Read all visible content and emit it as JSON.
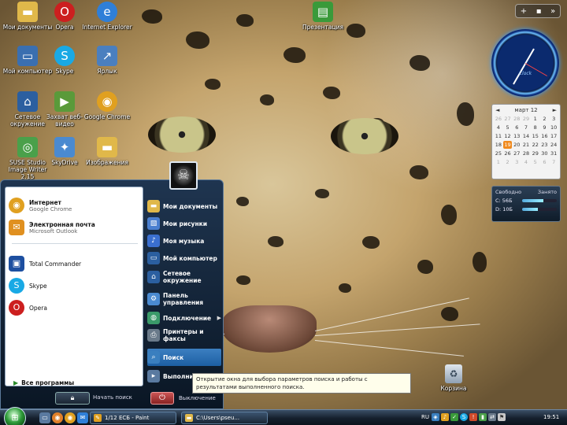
{
  "desktop": {
    "icons": [
      {
        "label": "Мои документы",
        "icon": "folder-icon",
        "color": "#e0b84a"
      },
      {
        "label": "Opera",
        "icon": "opera-icon",
        "color": "#cc1f1f"
      },
      {
        "label": "Internet Explorer",
        "icon": "ie-icon",
        "color": "#2f7fd8"
      },
      {
        "label": "Мой компьютер",
        "icon": "computer-icon",
        "color": "#3a6fb0"
      },
      {
        "label": "Skype",
        "icon": "skype-icon",
        "color": "#19a9e5"
      },
      {
        "label": "Ярлык",
        "icon": "shortcut-icon",
        "color": "#4a7fbf"
      },
      {
        "label": "Сетевое окружение",
        "icon": "network-icon",
        "color": "#2b5fa0"
      },
      {
        "label": "Захват веб-видео",
        "icon": "video-icon",
        "color": "#5a9a3a"
      },
      {
        "label": "Google Chrome",
        "icon": "chrome-icon",
        "color": "#e0a020"
      },
      {
        "label": "SUSE Studio Image Writer 2.15",
        "icon": "writer-icon",
        "color": "#4aa04a"
      },
      {
        "label": "SkyDrive",
        "icon": "skydrive-icon",
        "color": "#4a8ad0"
      },
      {
        "label": "Изображения",
        "icon": "pictures-folder-icon",
        "color": "#e0b84a"
      },
      {
        "label": "Презентация",
        "icon": "presentation-icon",
        "color": "#3a9a3a"
      }
    ],
    "recycle_bin": "Корзина"
  },
  "gadgets": {
    "controls": [
      "+",
      "▪",
      "»"
    ],
    "clock_brand": "Clock",
    "calendar": {
      "month": "март 12",
      "days": [
        "26",
        "27",
        "28",
        "29",
        "1",
        "2",
        "3",
        "4",
        "5",
        "6",
        "7",
        "8",
        "9",
        "10",
        "11",
        "12",
        "13",
        "14",
        "15",
        "16",
        "17",
        "18",
        "19",
        "20",
        "21",
        "22",
        "23",
        "24",
        "25",
        "26",
        "27",
        "28",
        "29",
        "30",
        "31",
        "1",
        "2",
        "3",
        "4",
        "5",
        "6",
        "7"
      ],
      "today": "19"
    },
    "drives": {
      "col1": "Свободно",
      "col2": "Занято",
      "rows": [
        {
          "name": "C: 56Б",
          "used": 0.62
        },
        {
          "name": "D: 10Б",
          "used": 0.45
        }
      ]
    }
  },
  "start_menu": {
    "pinned": [
      {
        "title": "Интернет",
        "sub": "Google Chrome",
        "icon": "chrome-icon",
        "color": "#e0a020"
      },
      {
        "title": "Электронная почта",
        "sub": "Microsoft Outlook",
        "icon": "mail-icon",
        "color": "#e09020"
      }
    ],
    "recent": [
      {
        "label": "Total Commander",
        "icon": "save-icon",
        "color": "#1d4fa0"
      },
      {
        "label": "Skype",
        "icon": "skype-icon",
        "color": "#19a9e5"
      },
      {
        "label": "Opera",
        "icon": "opera-icon",
        "color": "#cc1f1f"
      }
    ],
    "all_programs": "Все программы",
    "lock_label": "Начать поиск",
    "right": [
      {
        "label": "Мои документы",
        "icon": "folder-icon",
        "color": "#e0b84a"
      },
      {
        "label": "Мои рисунки",
        "icon": "pictures-icon",
        "color": "#4a7fd0"
      },
      {
        "label": "Моя музыка",
        "icon": "music-icon",
        "color": "#3a6fd0"
      },
      {
        "label": "Мой компьютер",
        "icon": "computer-icon",
        "color": "#2b5fa0"
      },
      {
        "label": "Сетевое окружение",
        "icon": "network-icon",
        "color": "#2b5fa0"
      },
      {
        "label": "Панель управления",
        "icon": "control-panel-icon",
        "color": "#4a8ad0"
      },
      {
        "label": "Подключение",
        "icon": "connect-icon",
        "color": "#3a9a6a"
      },
      {
        "label": "Принтеры и факсы",
        "icon": "printer-icon",
        "color": "#6a7a8a"
      },
      {
        "label": "Поиск",
        "icon": "search-icon",
        "color": "#3a7fbf"
      },
      {
        "label": "Выполнить",
        "icon": "run-icon",
        "color": "#5a7aa0"
      }
    ],
    "power_label": "Выключение"
  },
  "tooltip": "Открытие окна для выбора параметров поиска и работы с результатами выполненного поиска.",
  "taskbar": {
    "tasks": [
      {
        "label": "1/12 ЕСБ - Paint",
        "icon": "paint-icon",
        "color": "#e0a020"
      },
      {
        "label": "C:\\Users\\pseu...",
        "icon": "folder-icon",
        "color": "#e0b84a"
      }
    ],
    "lang": "RU",
    "tray": [
      "network-tray-icon",
      "volume-tray-icon",
      "security-tray-icon",
      "skype-tray-icon",
      "update-tray-icon",
      "battery-tray-icon",
      "usb-tray-icon",
      "flag-tray-icon"
    ],
    "clock": "19:51"
  }
}
